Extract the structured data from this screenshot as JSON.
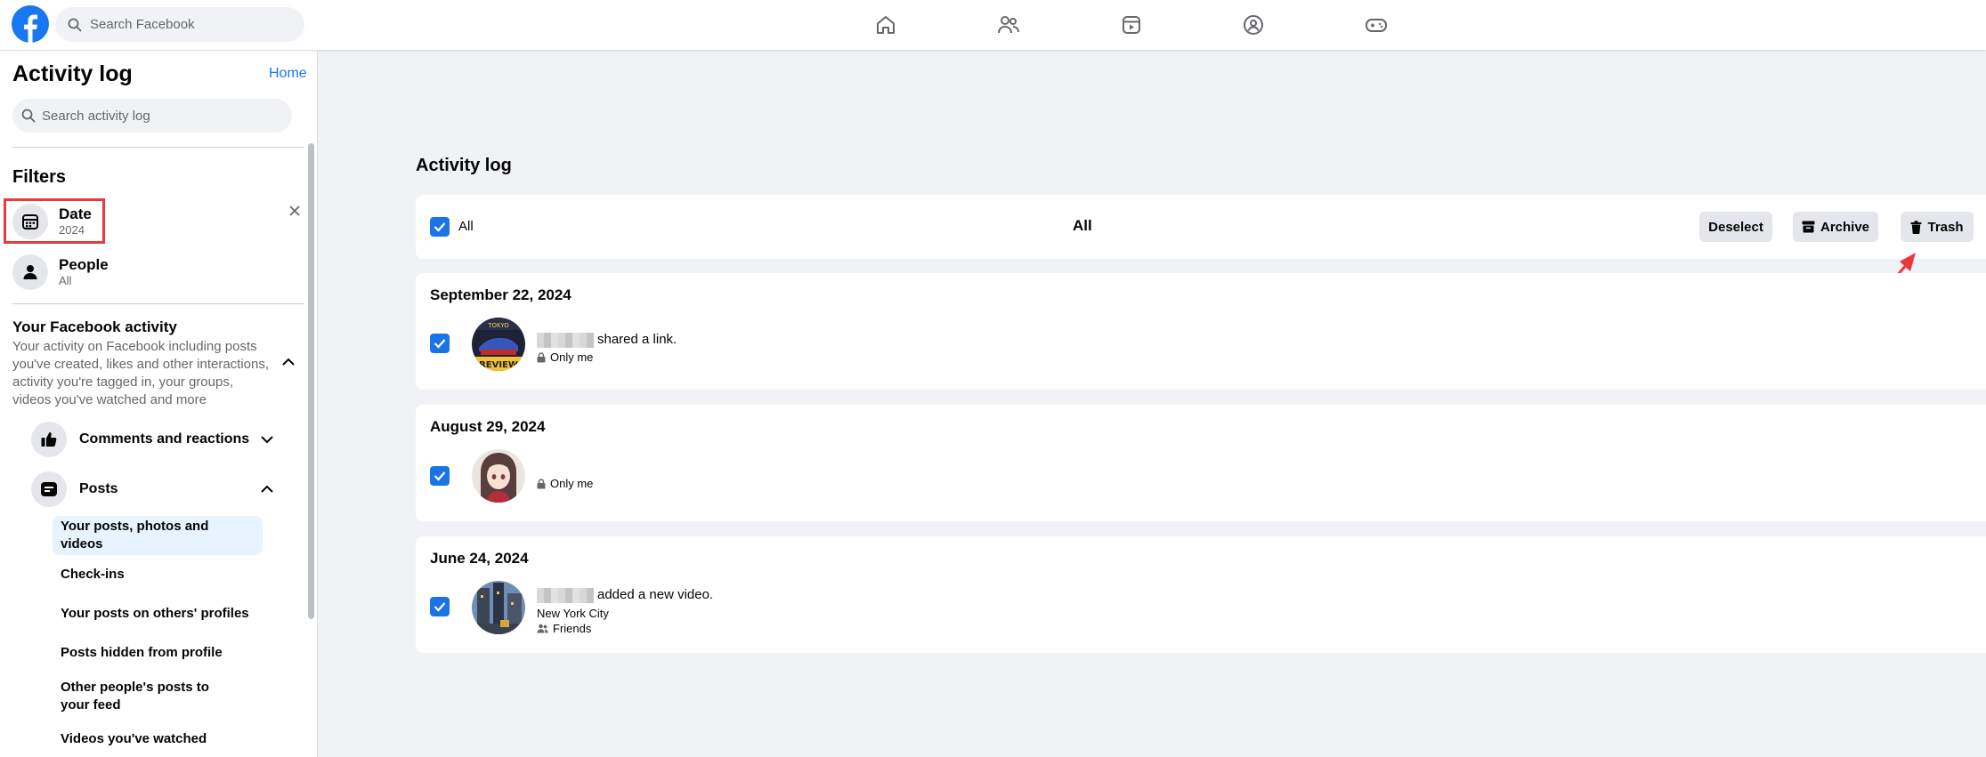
{
  "topbar": {
    "search_placeholder": "Search Facebook",
    "nav_icons": [
      "home-icon",
      "friends-icon",
      "video-icon",
      "groups-icon",
      "gaming-icon"
    ],
    "brand_color": "#1877f2"
  },
  "sidebar": {
    "title": "Activity log",
    "home_link": "Home",
    "search_placeholder": "Search activity log",
    "filters_heading": "Filters",
    "filters": [
      {
        "label": "Date",
        "value": "2024",
        "icon": "calendar-icon"
      },
      {
        "label": "People",
        "value": "All",
        "icon": "person-icon"
      }
    ],
    "activity_heading": "Your Facebook activity",
    "activity_desc": "Your activity on Facebook including posts you've created, likes and other interactions, activity you're tagged in, your groups, videos you've watched and more",
    "categories": [
      {
        "label": "Comments and reactions",
        "icon": "thumbs-up-icon",
        "expanded": false
      },
      {
        "label": "Posts",
        "icon": "post-icon",
        "expanded": true
      }
    ],
    "sub_items": [
      "Your posts, photos and videos",
      "Check-ins",
      "Your posts on others' profiles",
      "Posts hidden from profile",
      "Other people's posts to your feed",
      "Videos you've watched"
    ],
    "active_sub_item": "Your posts, photos and videos"
  },
  "main": {
    "title": "Activity log",
    "toolbar": {
      "select_all_label": "All",
      "center_label": "All",
      "deselect": "Deselect",
      "archive": "Archive",
      "trash": "Trash"
    },
    "groups": [
      {
        "date": "September 22, 2024",
        "action": "shared a link.",
        "privacy": "Only me"
      },
      {
        "date": "August 29, 2024",
        "action": "",
        "privacy": "Only me"
      },
      {
        "date": "June 24, 2024",
        "action": "added a new video.",
        "location": "New York City",
        "privacy": "Friends"
      }
    ]
  },
  "annotation_color": "#e8393c"
}
